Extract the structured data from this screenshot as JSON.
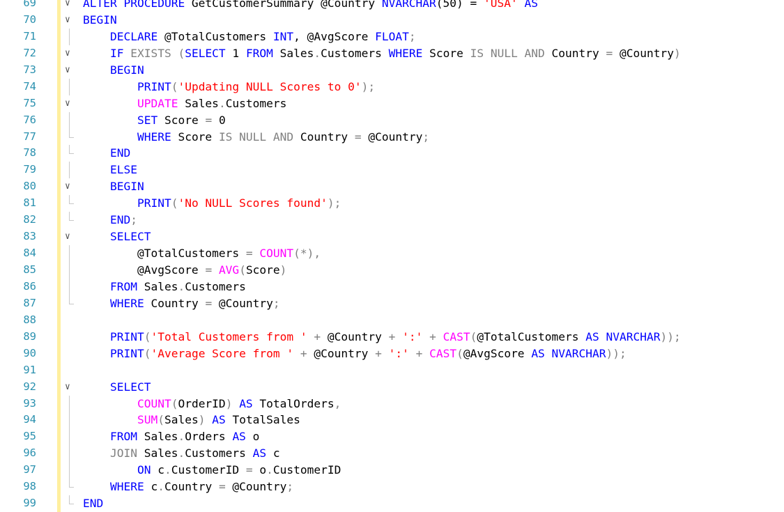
{
  "editor": {
    "line_numbers": [
      "69",
      "70",
      "71",
      "72",
      "73",
      "74",
      "75",
      "76",
      "77",
      "78",
      "79",
      "80",
      "81",
      "82",
      "83",
      "84",
      "85",
      "86",
      "87",
      "88",
      "89",
      "90",
      "91",
      "92",
      "93",
      "94",
      "95",
      "96",
      "97",
      "98",
      "99"
    ],
    "fold_markers": [
      "open",
      "open",
      "cont",
      "open",
      "open",
      "cont",
      "open",
      "cont",
      "end",
      "end",
      "cont",
      "open",
      "end",
      "end",
      "open",
      "cont",
      "cont",
      "cont",
      "end",
      "",
      "",
      "",
      "",
      "open",
      "cont",
      "cont",
      "cont",
      "cont",
      "cont",
      "end",
      "end"
    ],
    "colors": {
      "keyword": "#0000ff",
      "gray_keyword": "#808080",
      "string": "#ff0000",
      "function": "#ff00ff",
      "line_number": "#2b91af",
      "gutter_change_bar": "#ffef9e"
    },
    "lines": [
      [
        {
          "t": "ALTER PROCEDURE",
          "c": "kw"
        },
        {
          "t": " GetCustomerSummary @Country ",
          "c": "pl"
        },
        {
          "t": "NVARCHAR",
          "c": "kw"
        },
        {
          "t": "(50) = ",
          "c": "pl"
        },
        {
          "t": "'USA'",
          "c": "st"
        },
        {
          "t": " ",
          "c": "pl"
        },
        {
          "t": "AS",
          "c": "kw"
        }
      ],
      [
        {
          "t": "BEGIN",
          "c": "kw"
        }
      ],
      [
        {
          "t": "    ",
          "c": "pl"
        },
        {
          "t": "DECLARE",
          "c": "kw"
        },
        {
          "t": " @TotalCustomers ",
          "c": "pl"
        },
        {
          "t": "INT",
          "c": "kw"
        },
        {
          "t": ", @AvgScore ",
          "c": "pl"
        },
        {
          "t": "FLOAT",
          "c": "kw"
        },
        {
          "t": ";",
          "c": "gr"
        }
      ],
      [
        {
          "t": "    ",
          "c": "pl"
        },
        {
          "t": "IF",
          "c": "kw"
        },
        {
          "t": " EXISTS (",
          "c": "gr"
        },
        {
          "t": "SELECT",
          "c": "kw"
        },
        {
          "t": " 1 ",
          "c": "pl"
        },
        {
          "t": "FROM",
          "c": "kw"
        },
        {
          "t": " Sales",
          "c": "pl"
        },
        {
          "t": ".",
          "c": "gr"
        },
        {
          "t": "Customers ",
          "c": "pl"
        },
        {
          "t": "WHERE",
          "c": "kw"
        },
        {
          "t": " Score ",
          "c": "pl"
        },
        {
          "t": "IS NULL AND",
          "c": "gr"
        },
        {
          "t": " Country ",
          "c": "pl"
        },
        {
          "t": "=",
          "c": "gr"
        },
        {
          "t": " @Country",
          "c": "pl"
        },
        {
          "t": ")",
          "c": "gr"
        }
      ],
      [
        {
          "t": "    ",
          "c": "pl"
        },
        {
          "t": "BEGIN",
          "c": "kw"
        }
      ],
      [
        {
          "t": "        ",
          "c": "pl"
        },
        {
          "t": "PRINT",
          "c": "kw"
        },
        {
          "t": "(",
          "c": "gr"
        },
        {
          "t": "'Updating NULL Scores to 0'",
          "c": "st"
        },
        {
          "t": ");",
          "c": "gr"
        }
      ],
      [
        {
          "t": "        ",
          "c": "pl"
        },
        {
          "t": "UPDATE",
          "c": "fn"
        },
        {
          "t": " Sales",
          "c": "pl"
        },
        {
          "t": ".",
          "c": "gr"
        },
        {
          "t": "Customers",
          "c": "pl"
        }
      ],
      [
        {
          "t": "        ",
          "c": "pl"
        },
        {
          "t": "SET",
          "c": "kw"
        },
        {
          "t": " Score ",
          "c": "pl"
        },
        {
          "t": "=",
          "c": "gr"
        },
        {
          "t": " 0",
          "c": "pl"
        }
      ],
      [
        {
          "t": "        ",
          "c": "pl"
        },
        {
          "t": "WHERE",
          "c": "kw"
        },
        {
          "t": " Score ",
          "c": "pl"
        },
        {
          "t": "IS NULL AND",
          "c": "gr"
        },
        {
          "t": " Country ",
          "c": "pl"
        },
        {
          "t": "=",
          "c": "gr"
        },
        {
          "t": " @Country",
          "c": "pl"
        },
        {
          "t": ";",
          "c": "gr"
        }
      ],
      [
        {
          "t": "    ",
          "c": "pl"
        },
        {
          "t": "END",
          "c": "kw"
        }
      ],
      [
        {
          "t": "    ",
          "c": "pl"
        },
        {
          "t": "ELSE",
          "c": "kw"
        }
      ],
      [
        {
          "t": "    ",
          "c": "pl"
        },
        {
          "t": "BEGIN",
          "c": "kw"
        }
      ],
      [
        {
          "t": "        ",
          "c": "pl"
        },
        {
          "t": "PRINT",
          "c": "kw"
        },
        {
          "t": "(",
          "c": "gr"
        },
        {
          "t": "'No NULL Scores found'",
          "c": "st"
        },
        {
          "t": ");",
          "c": "gr"
        }
      ],
      [
        {
          "t": "    ",
          "c": "pl"
        },
        {
          "t": "END",
          "c": "kw"
        },
        {
          "t": ";",
          "c": "gr"
        }
      ],
      [
        {
          "t": "    ",
          "c": "pl"
        },
        {
          "t": "SELECT",
          "c": "kw"
        }
      ],
      [
        {
          "t": "        @TotalCustomers ",
          "c": "pl"
        },
        {
          "t": "=",
          "c": "gr"
        },
        {
          "t": " ",
          "c": "pl"
        },
        {
          "t": "COUNT",
          "c": "fn"
        },
        {
          "t": "(*),",
          "c": "gr"
        }
      ],
      [
        {
          "t": "        @AvgScore ",
          "c": "pl"
        },
        {
          "t": "=",
          "c": "gr"
        },
        {
          "t": " ",
          "c": "pl"
        },
        {
          "t": "AVG",
          "c": "fn"
        },
        {
          "t": "(",
          "c": "gr"
        },
        {
          "t": "Score",
          "c": "pl"
        },
        {
          "t": ")",
          "c": "gr"
        }
      ],
      [
        {
          "t": "    ",
          "c": "pl"
        },
        {
          "t": "FROM",
          "c": "kw"
        },
        {
          "t": " Sales",
          "c": "pl"
        },
        {
          "t": ".",
          "c": "gr"
        },
        {
          "t": "Customers",
          "c": "pl"
        }
      ],
      [
        {
          "t": "    ",
          "c": "pl"
        },
        {
          "t": "WHERE",
          "c": "kw"
        },
        {
          "t": " Country ",
          "c": "pl"
        },
        {
          "t": "=",
          "c": "gr"
        },
        {
          "t": " @Country",
          "c": "pl"
        },
        {
          "t": ";",
          "c": "gr"
        }
      ],
      [],
      [
        {
          "t": "    ",
          "c": "pl"
        },
        {
          "t": "PRINT",
          "c": "kw"
        },
        {
          "t": "(",
          "c": "gr"
        },
        {
          "t": "'Total Customers from '",
          "c": "st"
        },
        {
          "t": " + ",
          "c": "gr"
        },
        {
          "t": "@Country",
          "c": "pl"
        },
        {
          "t": " + ",
          "c": "gr"
        },
        {
          "t": "':'",
          "c": "st"
        },
        {
          "t": " + ",
          "c": "gr"
        },
        {
          "t": "CAST",
          "c": "fn"
        },
        {
          "t": "(",
          "c": "gr"
        },
        {
          "t": "@TotalCustomers ",
          "c": "pl"
        },
        {
          "t": "AS NVARCHAR",
          "c": "kw"
        },
        {
          "t": "));",
          "c": "gr"
        }
      ],
      [
        {
          "t": "    ",
          "c": "pl"
        },
        {
          "t": "PRINT",
          "c": "kw"
        },
        {
          "t": "(",
          "c": "gr"
        },
        {
          "t": "'Average Score from '",
          "c": "st"
        },
        {
          "t": " + ",
          "c": "gr"
        },
        {
          "t": "@Country",
          "c": "pl"
        },
        {
          "t": " + ",
          "c": "gr"
        },
        {
          "t": "':'",
          "c": "st"
        },
        {
          "t": " + ",
          "c": "gr"
        },
        {
          "t": "CAST",
          "c": "fn"
        },
        {
          "t": "(",
          "c": "gr"
        },
        {
          "t": "@AvgScore ",
          "c": "pl"
        },
        {
          "t": "AS NVARCHAR",
          "c": "kw"
        },
        {
          "t": "));",
          "c": "gr"
        }
      ],
      [],
      [
        {
          "t": "    ",
          "c": "pl"
        },
        {
          "t": "SELECT",
          "c": "kw"
        }
      ],
      [
        {
          "t": "        ",
          "c": "pl"
        },
        {
          "t": "COUNT",
          "c": "fn"
        },
        {
          "t": "(",
          "c": "gr"
        },
        {
          "t": "OrderID",
          "c": "pl"
        },
        {
          "t": ")",
          "c": "gr"
        },
        {
          "t": " ",
          "c": "pl"
        },
        {
          "t": "AS",
          "c": "kw"
        },
        {
          "t": " TotalOrders",
          "c": "pl"
        },
        {
          "t": ",",
          "c": "gr"
        }
      ],
      [
        {
          "t": "        ",
          "c": "pl"
        },
        {
          "t": "SUM",
          "c": "fn"
        },
        {
          "t": "(",
          "c": "gr"
        },
        {
          "t": "Sales",
          "c": "pl"
        },
        {
          "t": ")",
          "c": "gr"
        },
        {
          "t": " ",
          "c": "pl"
        },
        {
          "t": "AS",
          "c": "kw"
        },
        {
          "t": " TotalSales",
          "c": "pl"
        }
      ],
      [
        {
          "t": "    ",
          "c": "pl"
        },
        {
          "t": "FROM",
          "c": "kw"
        },
        {
          "t": " Sales",
          "c": "pl"
        },
        {
          "t": ".",
          "c": "gr"
        },
        {
          "t": "Orders ",
          "c": "pl"
        },
        {
          "t": "AS",
          "c": "kw"
        },
        {
          "t": " o",
          "c": "pl"
        }
      ],
      [
        {
          "t": "    ",
          "c": "pl"
        },
        {
          "t": "JOIN",
          "c": "gr"
        },
        {
          "t": " Sales",
          "c": "pl"
        },
        {
          "t": ".",
          "c": "gr"
        },
        {
          "t": "Customers ",
          "c": "pl"
        },
        {
          "t": "AS",
          "c": "kw"
        },
        {
          "t": " c",
          "c": "pl"
        }
      ],
      [
        {
          "t": "        ",
          "c": "pl"
        },
        {
          "t": "ON",
          "c": "kw"
        },
        {
          "t": " c",
          "c": "pl"
        },
        {
          "t": ".",
          "c": "gr"
        },
        {
          "t": "CustomerID ",
          "c": "pl"
        },
        {
          "t": "=",
          "c": "gr"
        },
        {
          "t": " o",
          "c": "pl"
        },
        {
          "t": ".",
          "c": "gr"
        },
        {
          "t": "CustomerID",
          "c": "pl"
        }
      ],
      [
        {
          "t": "    ",
          "c": "pl"
        },
        {
          "t": "WHERE",
          "c": "kw"
        },
        {
          "t": " c",
          "c": "pl"
        },
        {
          "t": ".",
          "c": "gr"
        },
        {
          "t": "Country ",
          "c": "pl"
        },
        {
          "t": "=",
          "c": "gr"
        },
        {
          "t": " @Country",
          "c": "pl"
        },
        {
          "t": ";",
          "c": "gr"
        }
      ],
      [
        {
          "t": "END",
          "c": "kw"
        }
      ]
    ]
  }
}
